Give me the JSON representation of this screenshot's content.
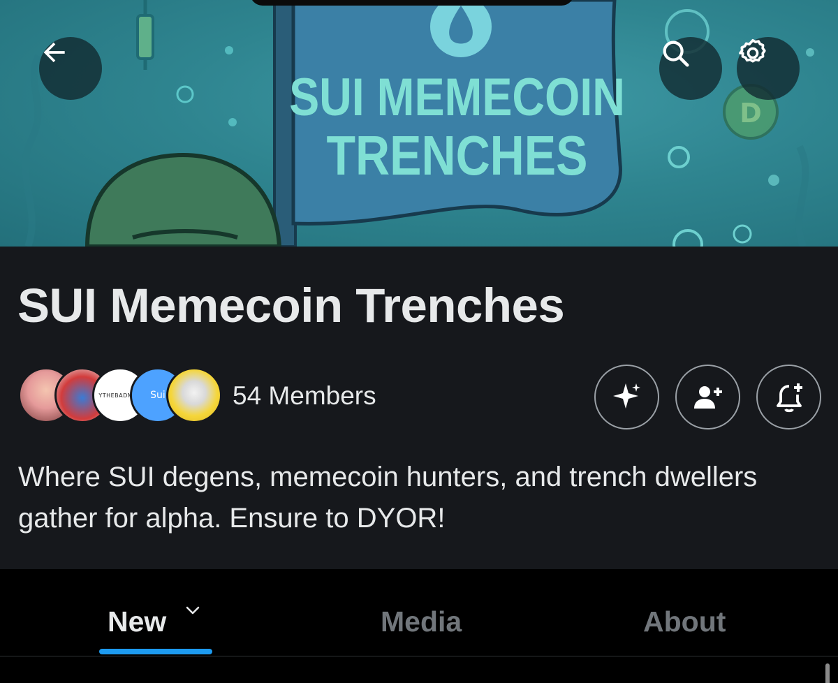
{
  "banner": {
    "flag_line1": "SUI MEMECOIN",
    "flag_line2": "TRENCHES",
    "coin_letter": "D"
  },
  "header": {
    "back_icon": "arrow-left-icon",
    "search_icon": "search-icon",
    "settings_icon": "gear-icon"
  },
  "community": {
    "title": "SUI Memecoin Trenches",
    "members_label": "54 Members",
    "description": "Where SUI degens, memecoin hunters, and trench dwellers gather for alpha. Ensure to DYOR!",
    "avatars": [
      {
        "kind": "anime-girl-avatar"
      },
      {
        "kind": "cartoon-king-avatar"
      },
      {
        "kind": "text-logo-avatar",
        "text": "YTHEBADMAN"
      },
      {
        "kind": "sui-logo-avatar",
        "text": "Sui"
      },
      {
        "kind": "skull-character-avatar"
      }
    ]
  },
  "actions": {
    "grok_icon": "sparkle-icon",
    "join_icon": "person-add-icon",
    "notify_icon": "bell-add-icon"
  },
  "tabs": {
    "new_label": "New",
    "media_label": "Media",
    "about_label": "About",
    "active": "New"
  },
  "colors": {
    "accent": "#1d9bf0",
    "background": "#000000",
    "panel": "#16181c",
    "banner": "#2f8590"
  }
}
